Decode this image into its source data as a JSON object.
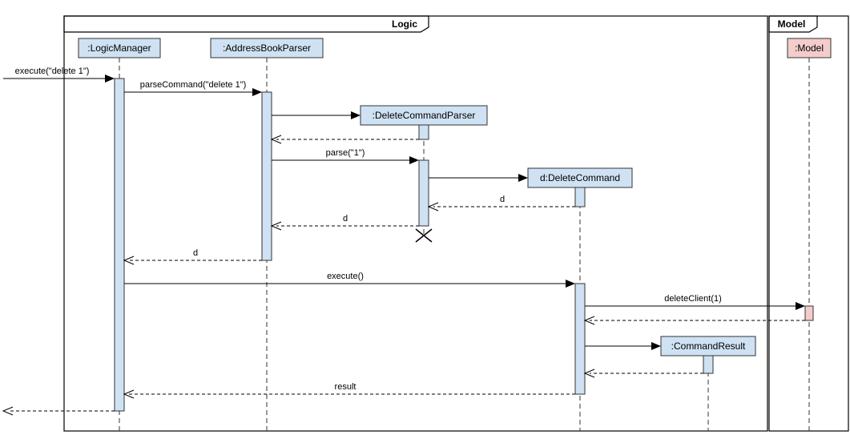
{
  "diagram": {
    "type": "sequence",
    "frames": {
      "logic": "Logic",
      "model": "Model"
    },
    "lifelines": {
      "logicManager": ":LogicManager",
      "addressBookParser": ":AddressBookParser",
      "deleteCommandParser": ":DeleteCommandParser",
      "deleteCommand": "d:DeleteCommand",
      "commandResult": ":CommandResult",
      "model": ":Model"
    },
    "messages": {
      "executeIn": "execute(\"delete 1\")",
      "parseCommand": "parseCommand(\"delete 1\")",
      "parse1": "parse(\"1\")",
      "returnD1": "d",
      "returnD2": "d",
      "returnD3": "d",
      "execute": "execute()",
      "deleteClient": "deleteClient(1)",
      "returnResult": "result"
    }
  }
}
